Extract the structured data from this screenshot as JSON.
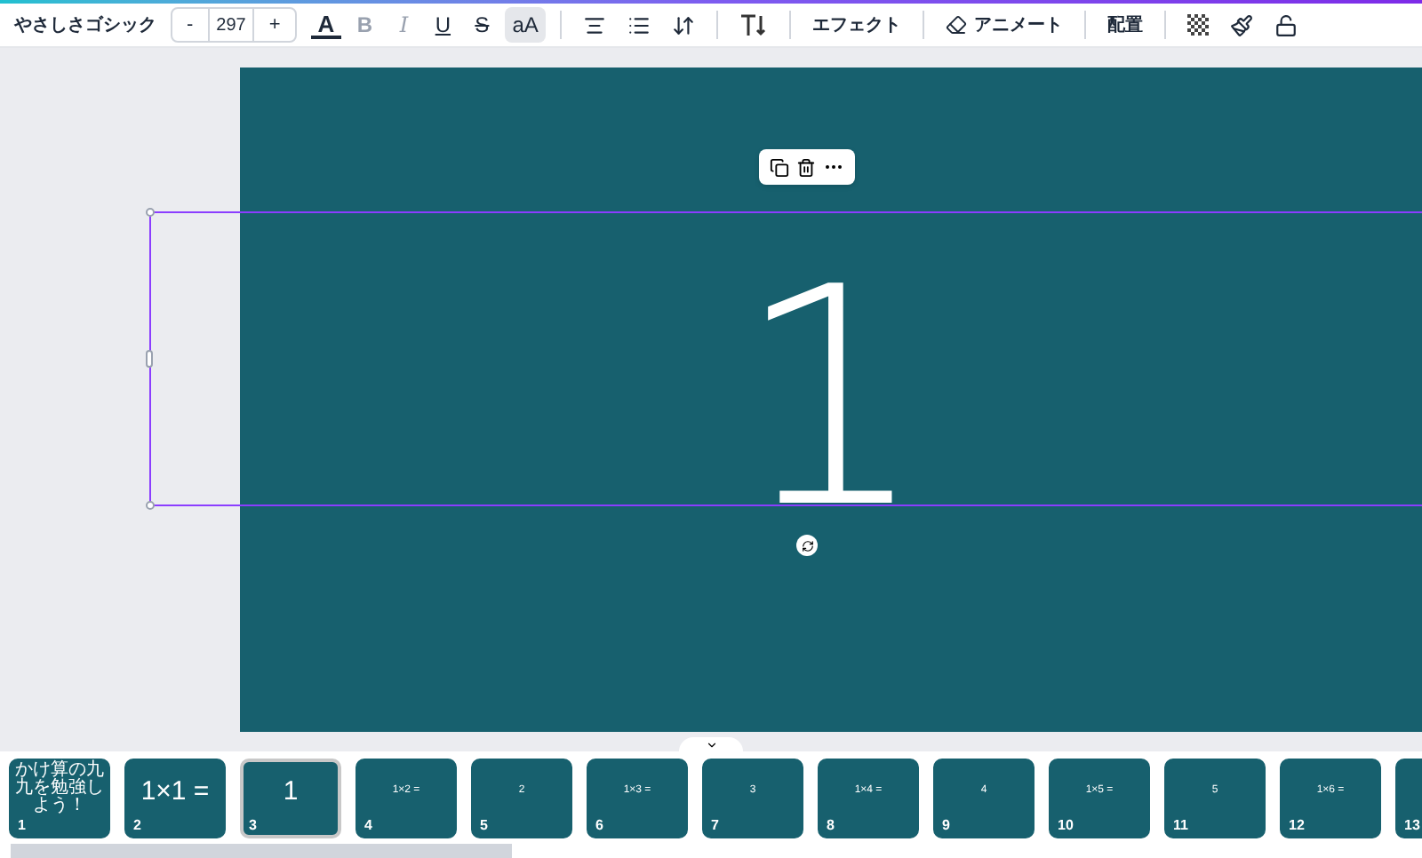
{
  "toolbar": {
    "font": "やさしさゴシック",
    "size_minus": "-",
    "font_size": "297",
    "size_plus": "+",
    "text_color": "A",
    "format_buttons": [
      {
        "label": "B",
        "disabled": true,
        "kind": "bold"
      },
      {
        "label": "I",
        "disabled": true,
        "kind": "italic"
      },
      {
        "label": "U",
        "disabled": false,
        "kind": "underline"
      },
      {
        "label": "S",
        "disabled": false,
        "kind": "strike"
      },
      {
        "label": "aA",
        "disabled": false,
        "kind": "case"
      }
    ],
    "case_selected": true,
    "effects": "エフェクト",
    "animate": "アニメート",
    "position": "配置"
  },
  "canvas": {
    "text": "1",
    "selected": true
  },
  "pages": [
    {
      "number": "1",
      "text": "かけ算の九九を勉強しよう！",
      "kind": "title",
      "selected": false
    },
    {
      "number": "2",
      "text": "1×1 =",
      "kind": "big",
      "selected": false
    },
    {
      "number": "3",
      "text": "1",
      "kind": "big",
      "selected": true
    },
    {
      "number": "4",
      "text": "1×2 =",
      "kind": "small",
      "selected": false
    },
    {
      "number": "5",
      "text": "2",
      "kind": "small",
      "selected": false
    },
    {
      "number": "6",
      "text": "1×3 =",
      "kind": "small",
      "selected": false
    },
    {
      "number": "7",
      "text": "3",
      "kind": "small",
      "selected": false
    },
    {
      "number": "8",
      "text": "1×4 =",
      "kind": "small",
      "selected": false
    },
    {
      "number": "9",
      "text": "4",
      "kind": "small",
      "selected": false
    },
    {
      "number": "10",
      "text": "1×5 =",
      "kind": "small",
      "selected": false
    },
    {
      "number": "11",
      "text": "5",
      "kind": "small",
      "selected": false
    },
    {
      "number": "12",
      "text": "1×6 =",
      "kind": "small",
      "selected": false
    },
    {
      "number": "13",
      "kind": "cut",
      "selected": false
    }
  ]
}
